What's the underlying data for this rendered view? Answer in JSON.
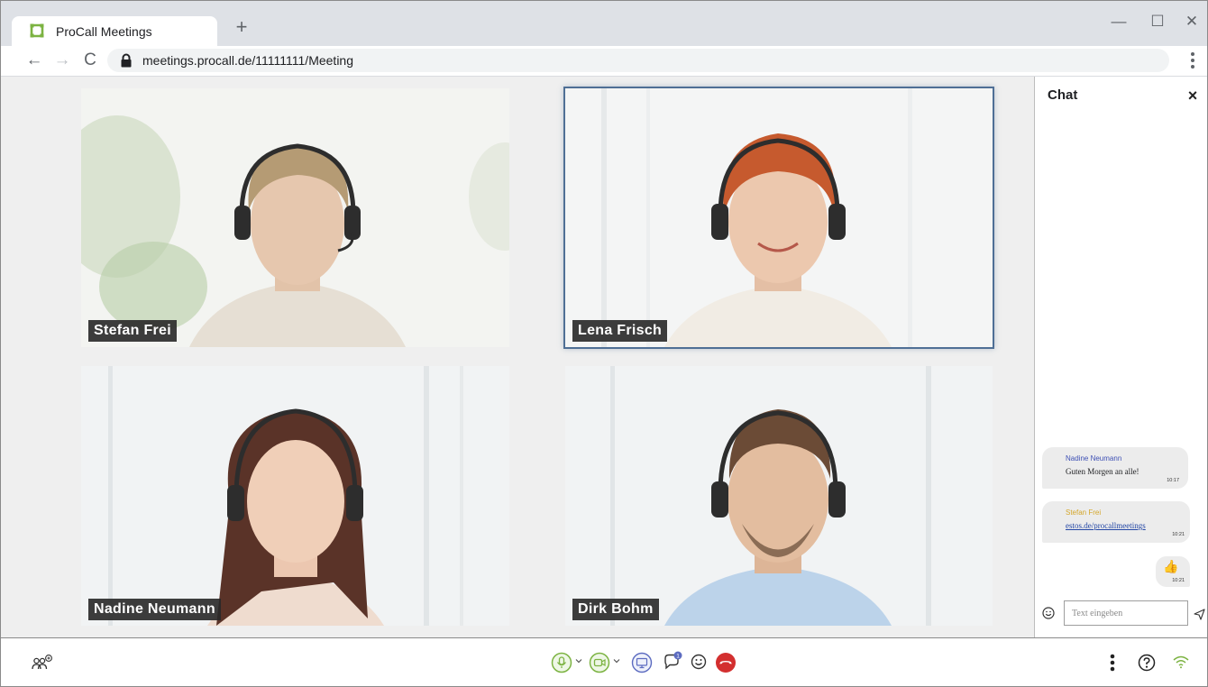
{
  "browser": {
    "tab_title": "ProCall Meetings",
    "new_tab_label": "+",
    "url": "meetings.procall.de/11111111/Meeting",
    "minimize_label": "—",
    "maximize_label": "☐",
    "close_label": "✕",
    "back_label": "←",
    "forward_label": "→",
    "reload_label": "C",
    "brand_color": "#7cb342"
  },
  "participants": [
    {
      "name": "Stefan Frei",
      "active": false
    },
    {
      "name": "Lena Frisch",
      "active": true
    },
    {
      "name": "Nadine Neumann",
      "active": false
    },
    {
      "name": "Dirk Bohm",
      "active": false
    }
  ],
  "chat": {
    "title": "Chat",
    "close_label": "×",
    "messages": [
      {
        "sender": "Nadine Neumann",
        "text": "Guten Morgen an alle!",
        "time": "10:17",
        "sender_color": "#3f51b5"
      },
      {
        "sender": "Stefan Frei",
        "text": "estos.de/procallmeetings",
        "time": "10:21",
        "sender_color": "#d4a72c",
        "is_link": true
      },
      {
        "sender": "",
        "text": "👍",
        "time": "10:21",
        "own": true
      }
    ],
    "input_placeholder": "Text eingeben",
    "input_value": ""
  },
  "controls": {
    "left": [
      "participants-icon"
    ],
    "center": [
      "microphone-icon",
      "camera-icon",
      "screen-share-icon",
      "chat-icon",
      "emoji-icon",
      "hang-up-icon"
    ],
    "right": [
      "more-options-icon",
      "help-icon",
      "connection-quality-icon"
    ],
    "chat_badge": "1",
    "active_color": "#7cb342",
    "hangup_color": "#d32f2f"
  }
}
